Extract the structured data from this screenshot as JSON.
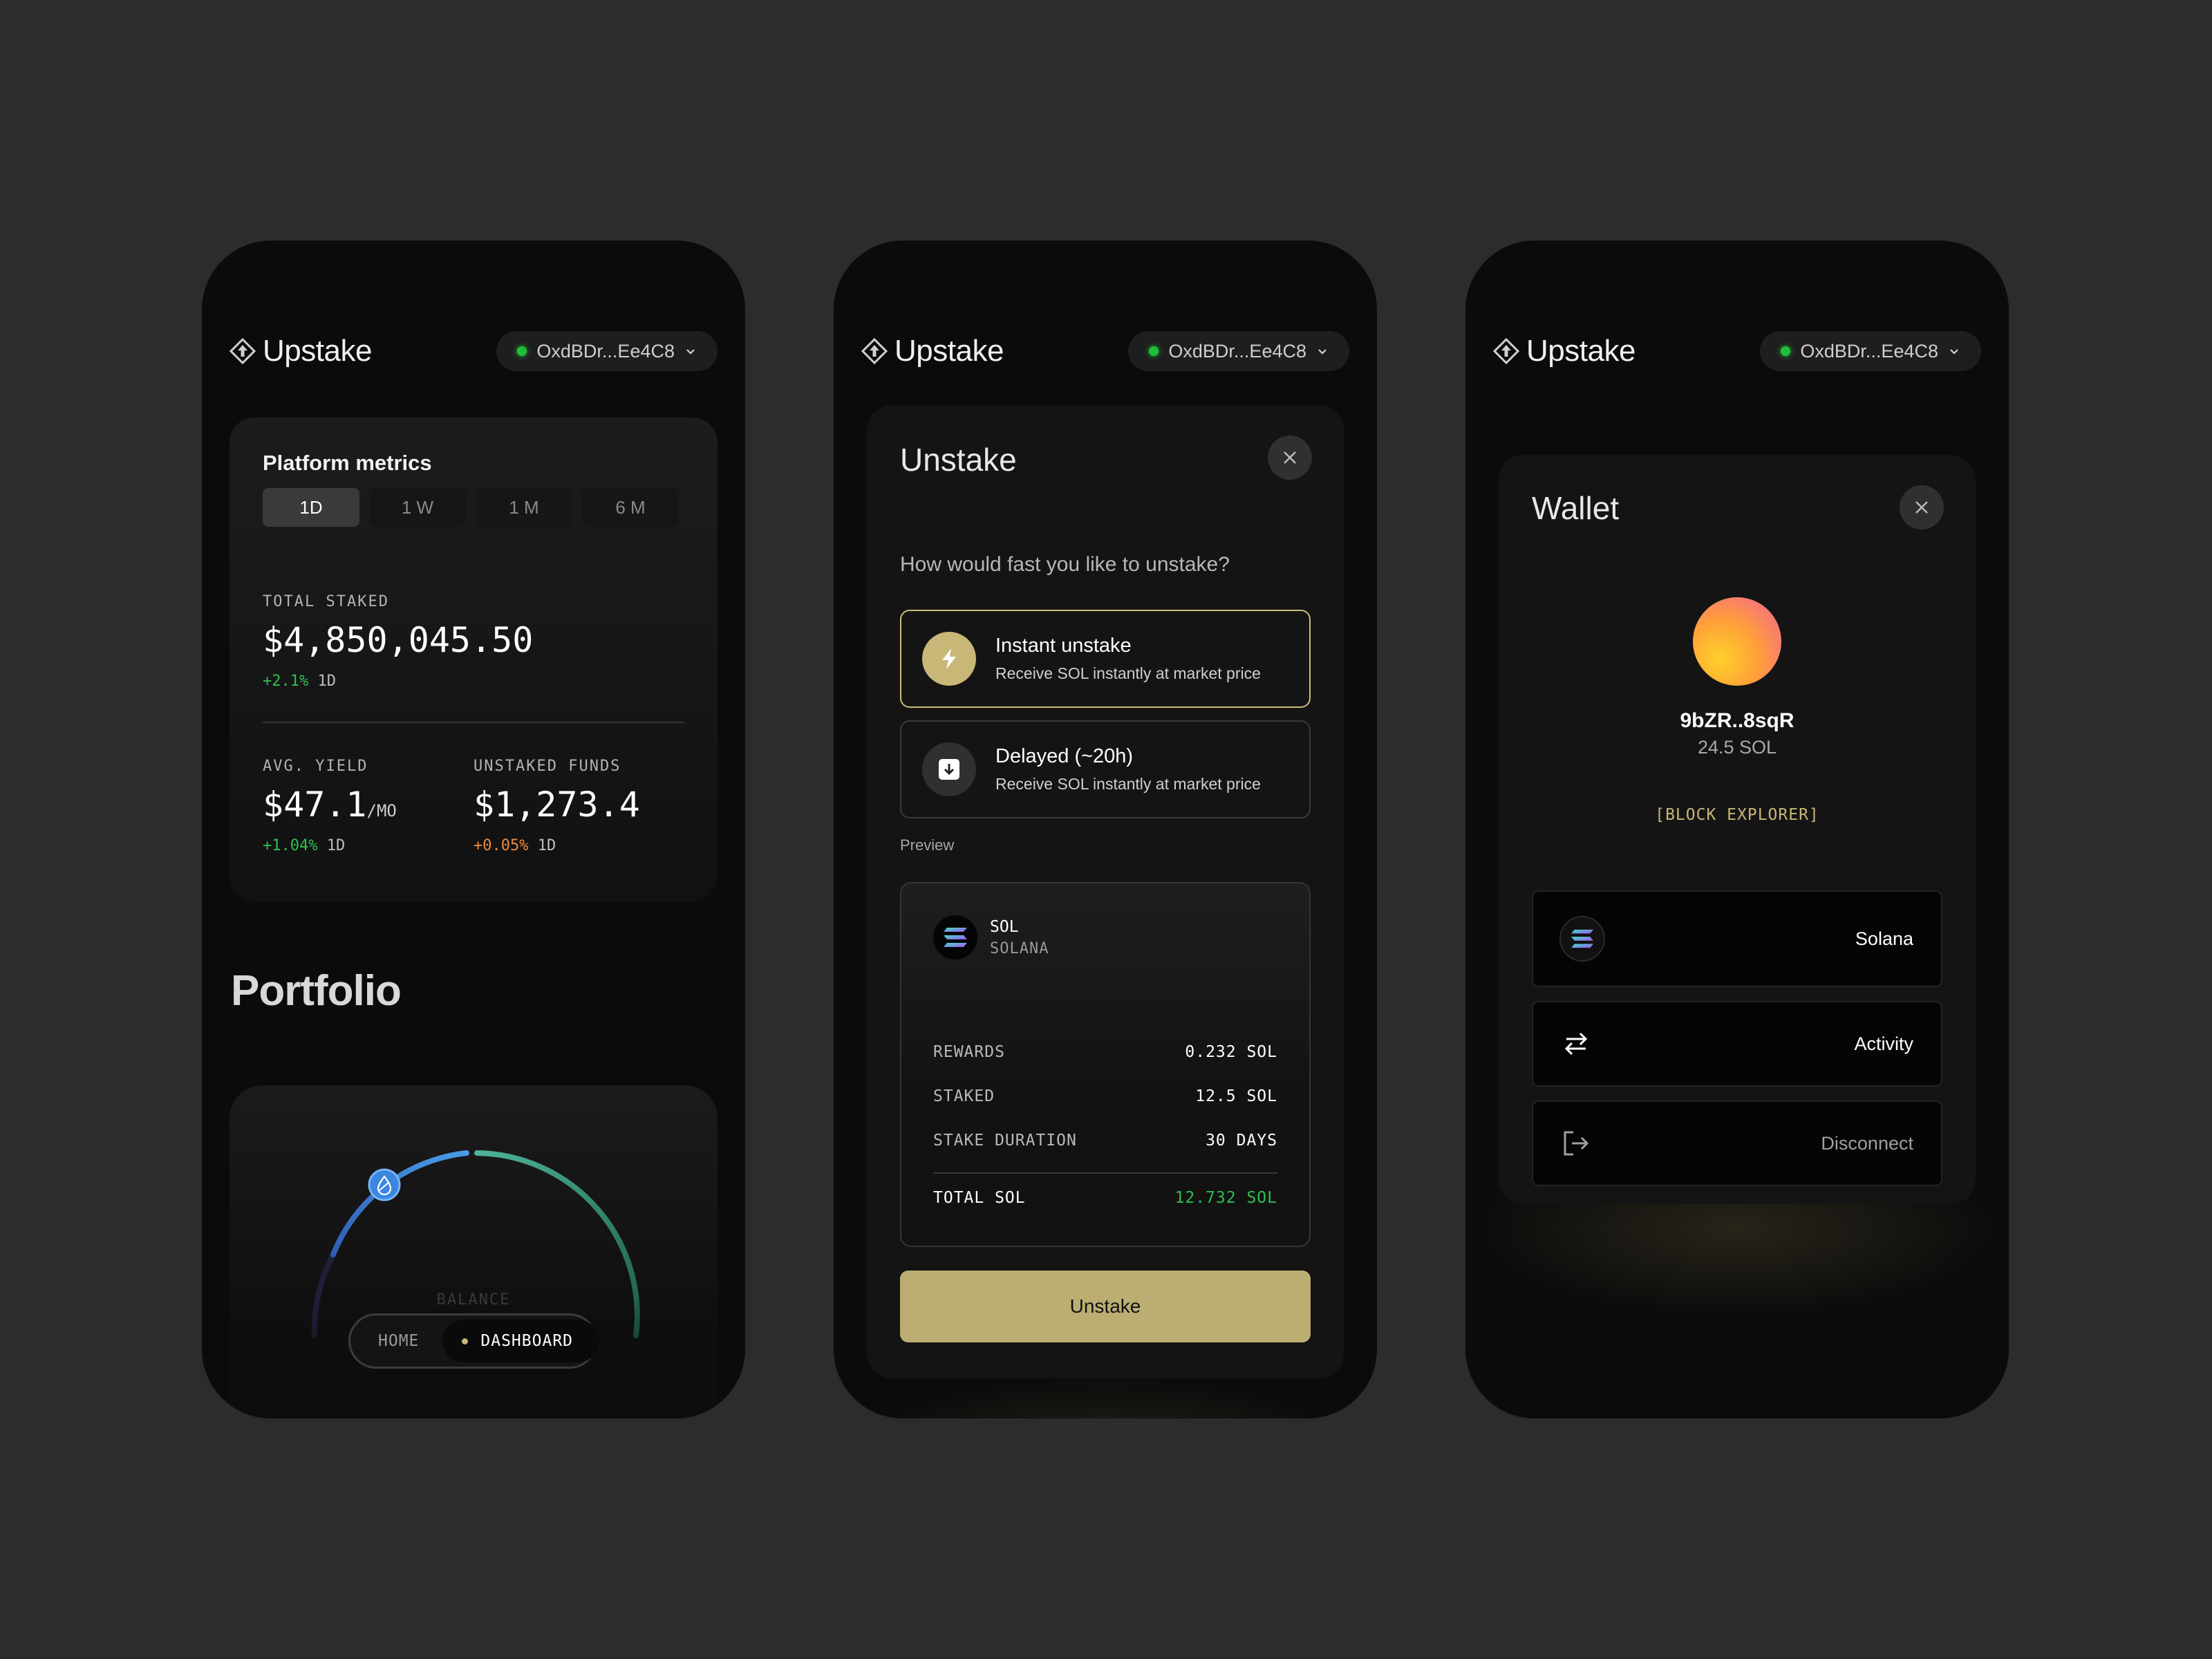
{
  "header": {
    "brand": "Upstake",
    "wallet_address": "OxdBDr...Ee4C8"
  },
  "dashboard": {
    "metrics_title": "Platform metrics",
    "ranges": [
      "1D",
      "1 W",
      "1 M",
      "6 M"
    ],
    "active_range": "1D",
    "total_staked": {
      "label": "TOTAL STAKED",
      "value": "$4,850,045.50",
      "change": "+2.1%",
      "period": "1D"
    },
    "avg_yield": {
      "label": "AVG. YIELD",
      "value": "$47.1",
      "unit": "/MO",
      "change": "+1.04%",
      "period": "1D"
    },
    "unstaked_funds": {
      "label": "UNSTAKED FUNDS",
      "value": "$1,273.4",
      "change": "+0.05%",
      "period": "1D"
    },
    "portfolio_title": "Portfolio",
    "balance_label": "BALANCE",
    "nav": {
      "home": "HOME",
      "dashboard": "DASHBOARD"
    }
  },
  "unstake": {
    "title": "Unstake",
    "question": "How would fast you like to unstake?",
    "options": [
      {
        "title": "Instant unstake",
        "subtitle": "Receive SOL instantly at market price",
        "icon": "lightning-icon",
        "selected": true
      },
      {
        "title": "Delayed (~20h)",
        "subtitle": "Receive SOL instantly at market price",
        "icon": "download-icon",
        "selected": false
      }
    ],
    "preview_label": "Preview",
    "token_symbol": "SOL",
    "token_name": "SOLANA",
    "rows": [
      {
        "label": "REWARDS",
        "value": "0.232 SOL"
      },
      {
        "label": "STAKED",
        "value": "12.5 SOL"
      },
      {
        "label": "STAKE DURATION",
        "value": "30 DAYS"
      }
    ],
    "total": {
      "label": "TOTAL SOL",
      "value": "12.732 SOL"
    },
    "button": "Unstake"
  },
  "wallet": {
    "title": "Wallet",
    "address": "9bZR..8sqR",
    "balance": "24.5 SOL",
    "explorer": "[BLOCK EXPLORER]",
    "rows": [
      {
        "label": "Solana",
        "icon": "solana-icon"
      },
      {
        "label": "Activity",
        "icon": "swap-arrows-icon"
      },
      {
        "label": "Disconnect",
        "icon": "logout-icon"
      }
    ]
  },
  "colors": {
    "background": "#2c2c2c",
    "accent_gold": "#bcae72",
    "positive": "#2fbf4f",
    "negative": "#f08a3c",
    "status_dot": "#1fbf3a"
  }
}
